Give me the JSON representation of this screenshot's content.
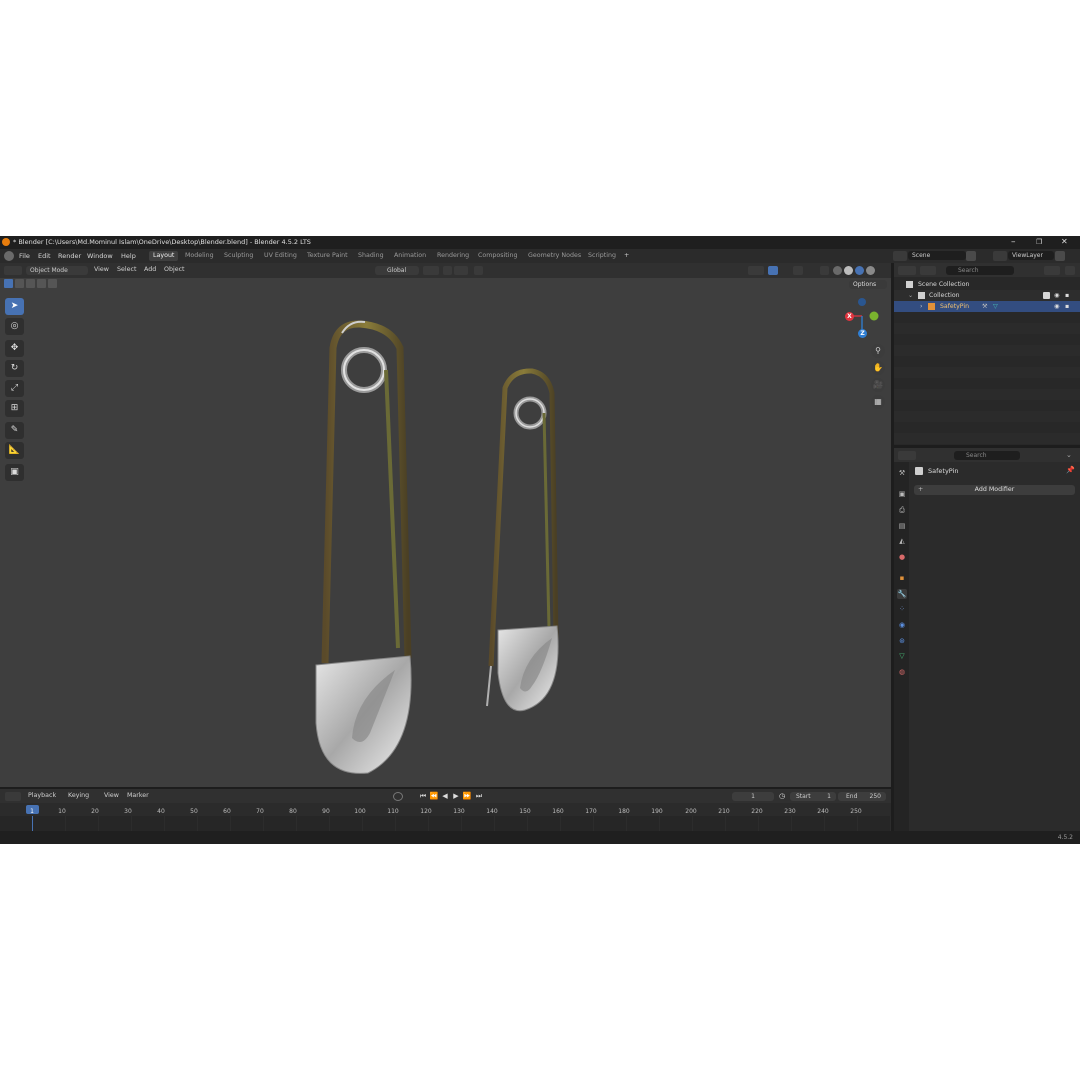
{
  "window": {
    "title": "* Blender [C:\\Users\\Md.Mominul Islam\\OneDrive\\Desktop\\Blender.blend] - Blender 4.5.2 LTS",
    "controls": {
      "minimize": "–",
      "maximize": "❐",
      "close": "✕"
    }
  },
  "menu": [
    "File",
    "Edit",
    "Render",
    "Window",
    "Help"
  ],
  "workspaces": [
    "Layout",
    "Modeling",
    "Sculpting",
    "UV Editing",
    "Texture Paint",
    "Shading",
    "Animation",
    "Rendering",
    "Compositing",
    "Geometry Nodes",
    "Scripting"
  ],
  "active_workspace": "Layout",
  "add_workspace": "+",
  "scene": {
    "name": "Scene",
    "view_layer": "ViewLayer"
  },
  "viewport_header": {
    "mode": "Object Mode",
    "menus": [
      "View",
      "Select",
      "Add",
      "Object"
    ],
    "transform_orientation": "Global",
    "options": "Options"
  },
  "gizmo": {
    "x": "X",
    "y": "Y",
    "z": "Z"
  },
  "outliner": {
    "search_placeholder": "Search",
    "scene_collection": "Scene Collection",
    "collection": "Collection",
    "object": "SafetyPin"
  },
  "properties": {
    "search_placeholder": "Search",
    "object_name": "SafetyPin",
    "add_modifier": "Add Modifier"
  },
  "timeline": {
    "menus": [
      "Playback",
      "Keying",
      "View",
      "Marker"
    ],
    "current_frame": "1",
    "start_label": "Start",
    "start": "1",
    "end_label": "End",
    "end": "250",
    "ticks": [
      "1",
      "10",
      "20",
      "30",
      "40",
      "50",
      "60",
      "70",
      "80",
      "90",
      "100",
      "110",
      "120",
      "130",
      "140",
      "150",
      "160",
      "170",
      "180",
      "190",
      "200",
      "210",
      "220",
      "230",
      "240",
      "250"
    ]
  },
  "status": {
    "version": "4.5.2"
  },
  "colors": {
    "accent": "#4772b3",
    "x_axis": "#e0343f",
    "y_axis": "#7ab32e",
    "z_axis": "#2f7fd4",
    "viewport_bg": "#3e3e3e"
  }
}
